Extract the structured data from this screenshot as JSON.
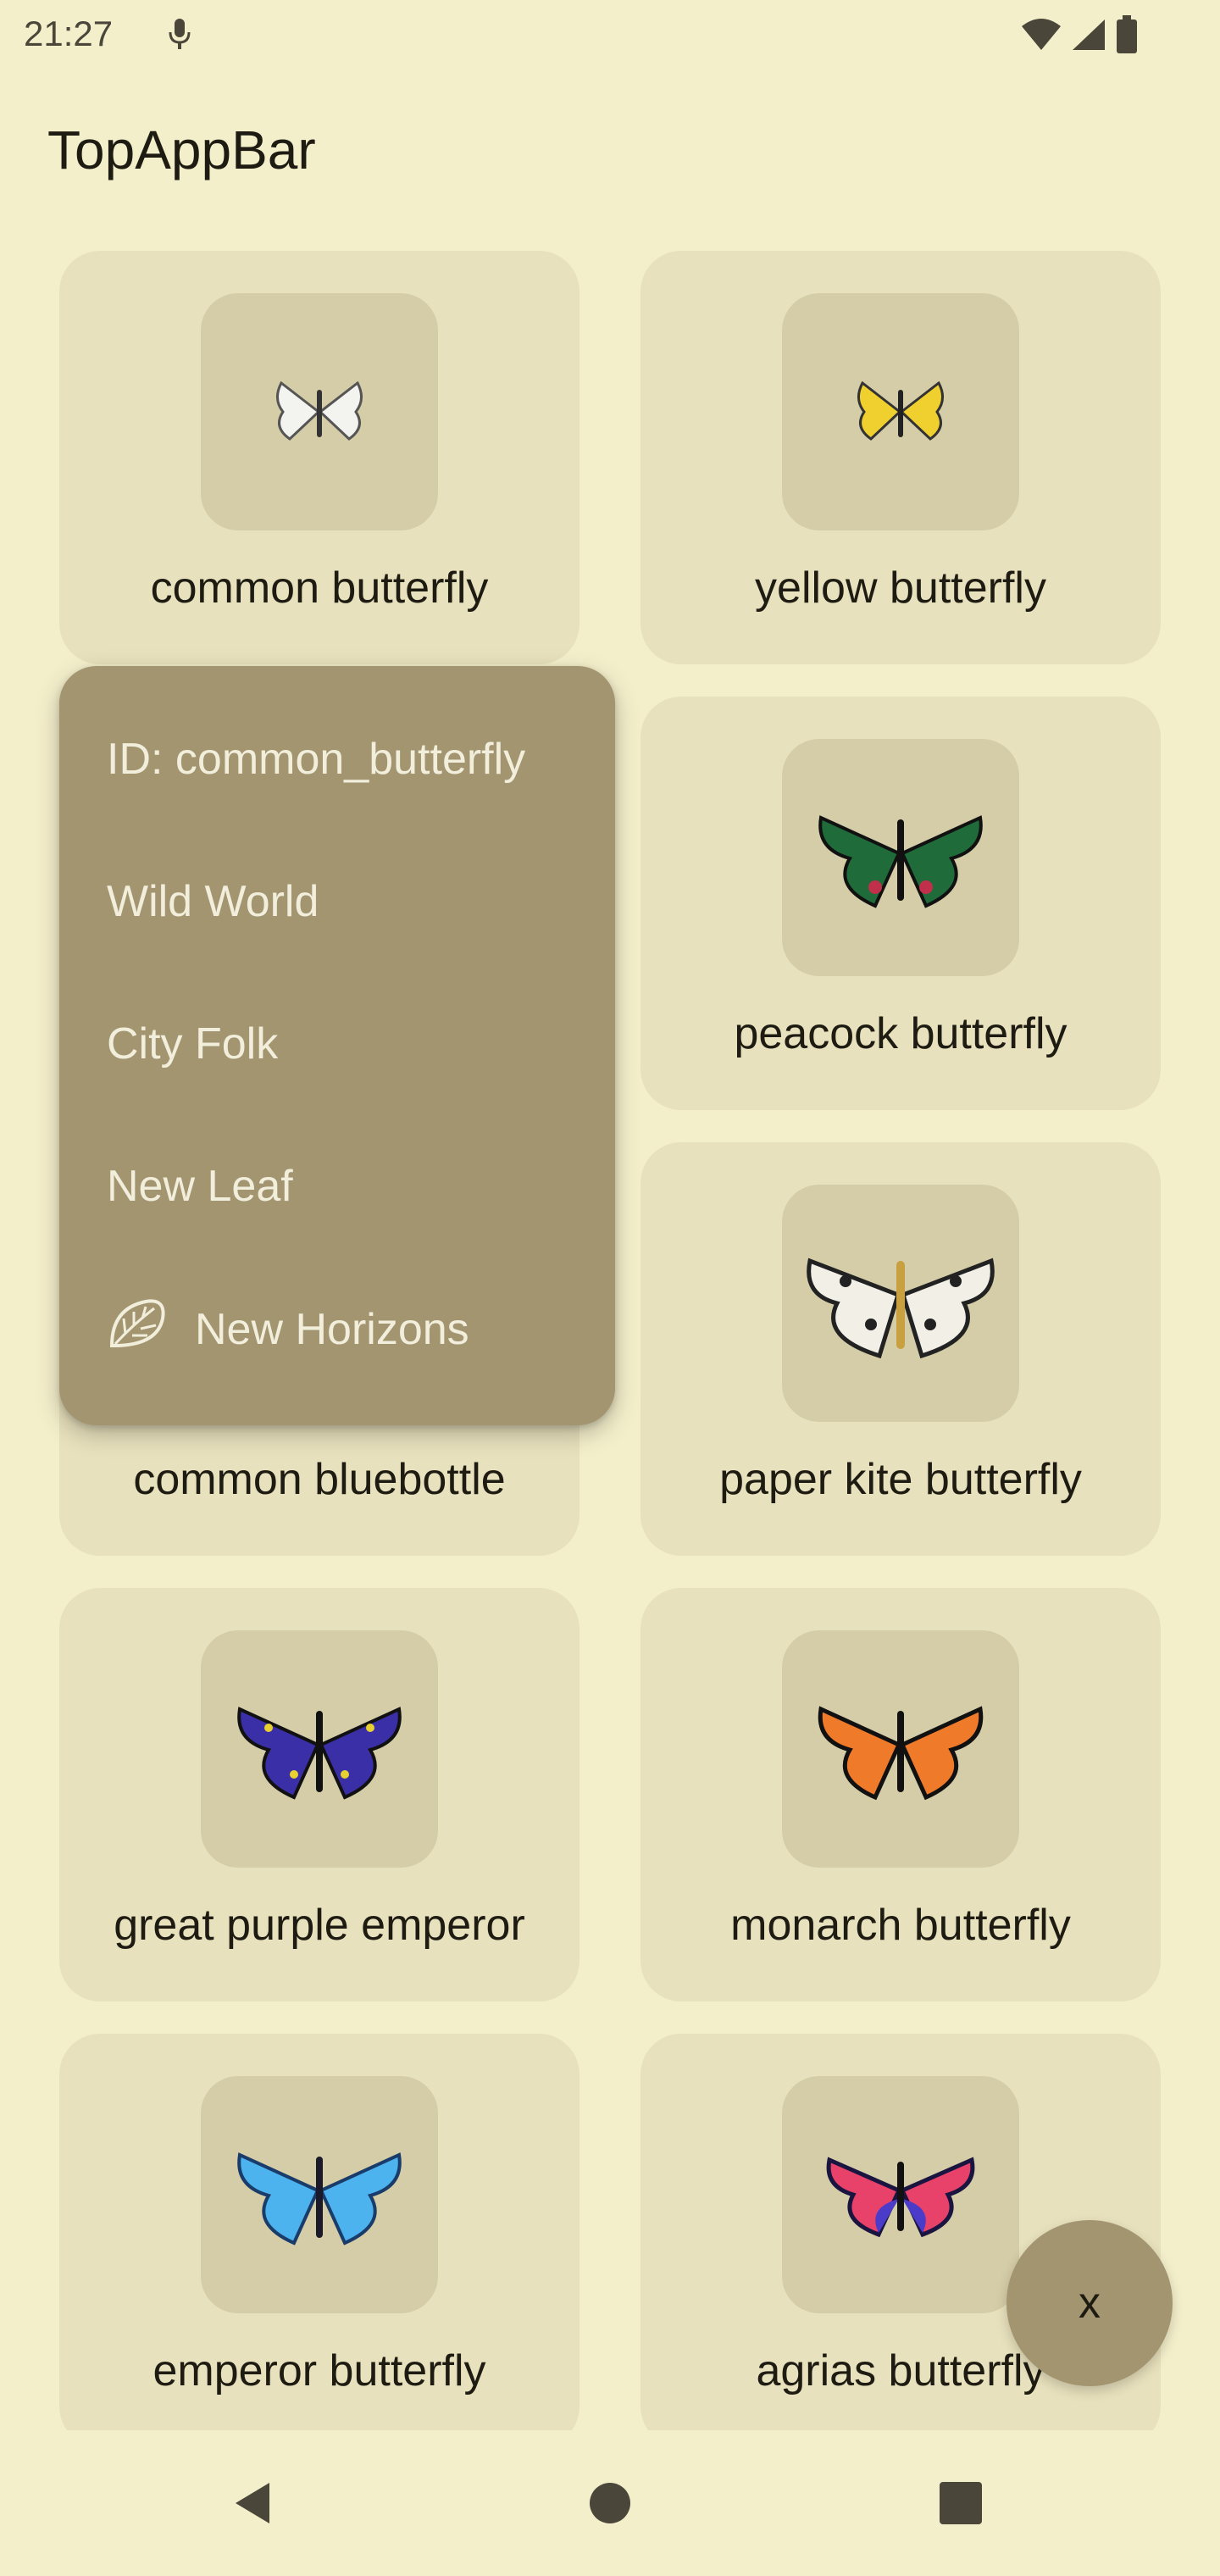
{
  "status_bar": {
    "time": "21:27"
  },
  "app_bar": {
    "title": "TopAppBar"
  },
  "cards": [
    {
      "label": "common butterfly"
    },
    {
      "label": "yellow butterfly"
    },
    {
      "label": ""
    },
    {
      "label": "peacock butterfly"
    },
    {
      "label": "common bluebottle"
    },
    {
      "label": "paper kite butterfly"
    },
    {
      "label": "great purple emperor"
    },
    {
      "label": "monarch butterfly"
    },
    {
      "label": "emperor butterfly"
    },
    {
      "label": "agrias butterfly"
    }
  ],
  "context_menu": {
    "items": [
      {
        "label": "ID: common_butterfly"
      },
      {
        "label": "Wild World"
      },
      {
        "label": "City Folk"
      },
      {
        "label": "New Leaf"
      },
      {
        "label": "New Horizons",
        "icon": "leaf-icon"
      }
    ]
  },
  "fab": {
    "label": "x"
  },
  "nav": {
    "back": "back-icon",
    "home": "home-icon",
    "recents": "recents-icon"
  },
  "colors": {
    "background": "#f4efcb",
    "card": "#e8e1bd",
    "thumb": "#d5cda7",
    "menu": "#a39570",
    "menu_text": "#f2eedc"
  }
}
